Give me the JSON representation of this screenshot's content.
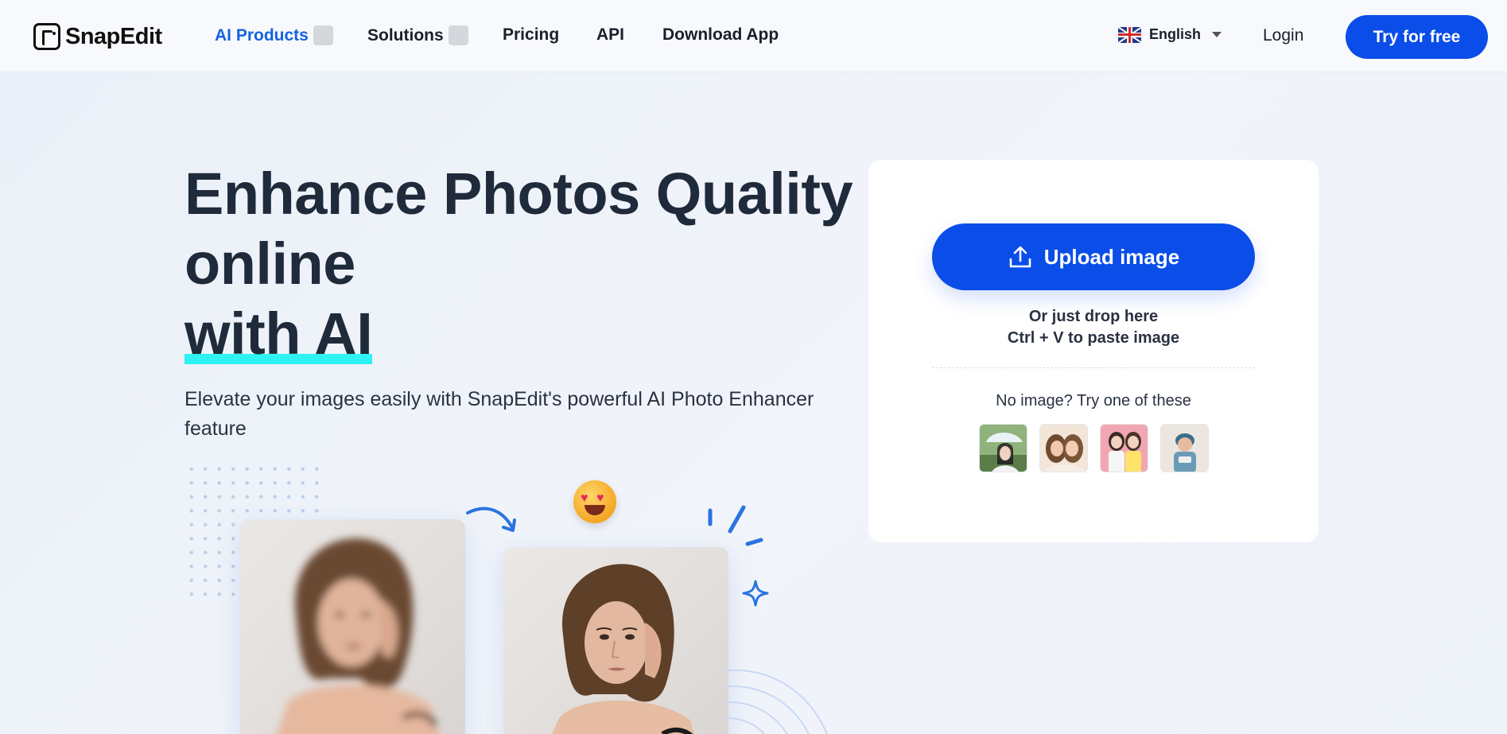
{
  "brand": {
    "name": "SnapEdit"
  },
  "nav": {
    "items": [
      {
        "label": "AI Products",
        "active": true,
        "has_dropdown": true
      },
      {
        "label": "Solutions",
        "active": false,
        "has_dropdown": true
      },
      {
        "label": "Pricing",
        "active": false,
        "has_dropdown": false
      },
      {
        "label": "API",
        "active": false,
        "has_dropdown": false
      },
      {
        "label": "Download App",
        "active": false,
        "has_dropdown": false
      }
    ],
    "language": {
      "label": "English",
      "flag": "uk-flag-icon"
    },
    "login_label": "Login",
    "cta_label": "Try for free"
  },
  "hero": {
    "title_line1": "Enhance Photos Quality",
    "title_line2": "online",
    "title_highlight": "with AI",
    "subtitle": "Elevate your images easily with SnapEdit's powerful AI Photo Enhancer feature"
  },
  "upload": {
    "button_label": "Upload image",
    "drop_hint": "Or just drop here",
    "paste_hint": "Ctrl + V to paste image",
    "samples_label": "No image? Try one of these",
    "samples": [
      {
        "icon": "sample-photo-woman-umbrella"
      },
      {
        "icon": "sample-photo-two-women"
      },
      {
        "icon": "sample-photo-two-girls"
      },
      {
        "icon": "sample-photo-baby"
      }
    ]
  },
  "colors": {
    "accent": "#0a4de8",
    "active_nav": "#1663e0",
    "highlight": "#2ff2f2",
    "decoration": "#2a73e0"
  }
}
